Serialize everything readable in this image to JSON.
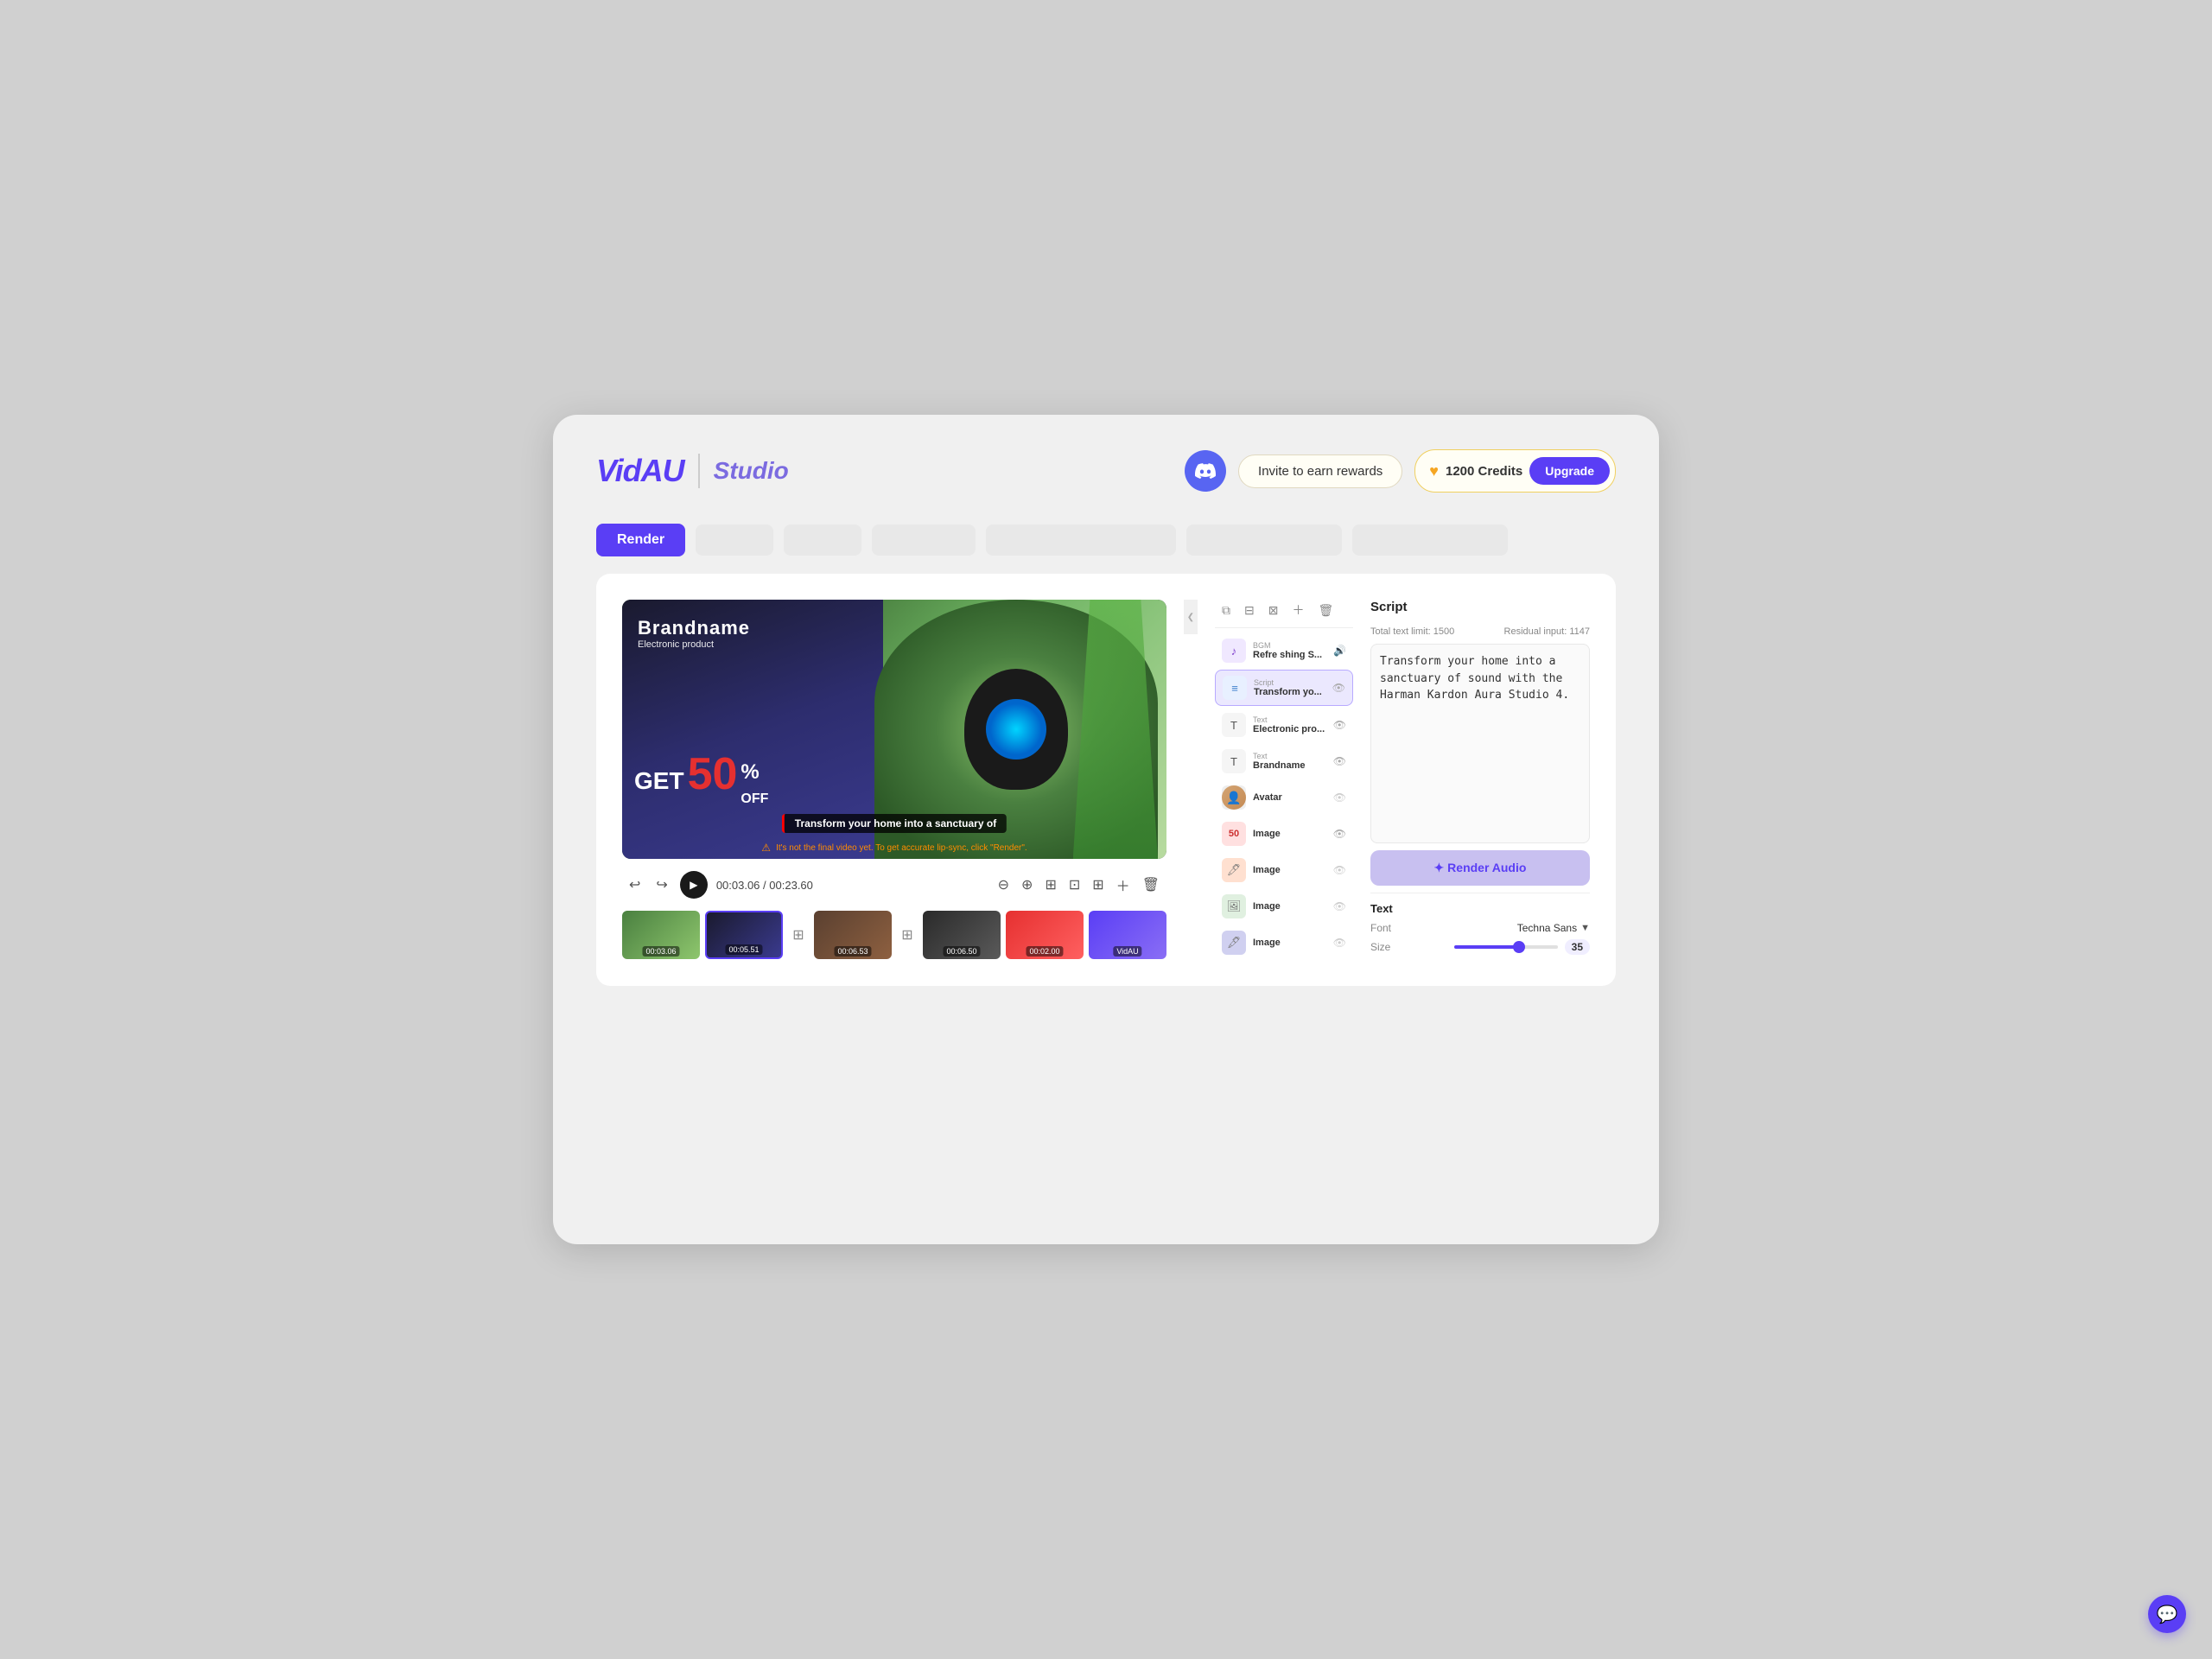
{
  "app": {
    "logo": "VidAU",
    "subtitle": "Studio"
  },
  "header": {
    "discord_label": "Discord",
    "invite_label": "Invite to earn rewards",
    "credits_icon": "♥",
    "credits_amount": "1200 Credits",
    "upgrade_label": "Upgrade"
  },
  "toolbar": {
    "render_label": "Render",
    "tabs": [
      "",
      "",
      "",
      "",
      "",
      ""
    ]
  },
  "video": {
    "ad": {
      "brand": "Brandname",
      "sub": "Electronic product",
      "get": "GET",
      "percent": "50",
      "percent_sign": "%",
      "off": "OFF"
    },
    "subtitle": "Transform your home into a sanctuary of",
    "warning": "It's not the final video yet. To get accurate lip-sync, click \"Render\".",
    "time_current": "00:03.06",
    "time_total": "00:23.60"
  },
  "timeline": {
    "clips": [
      {
        "time": "00:03.06",
        "active": false
      },
      {
        "time": "00:05.51",
        "active": true
      },
      {
        "time": "00:06.53",
        "active": false
      },
      {
        "time": "00:06.50",
        "active": false
      },
      {
        "time": "00:02.00",
        "active": false
      }
    ]
  },
  "layers": {
    "panel_tools": [
      "copy",
      "align-h",
      "align-v",
      "add",
      "delete"
    ],
    "items": [
      {
        "type": "BGM",
        "name": "Refre shing S...",
        "icon_type": "music",
        "visible": true
      },
      {
        "type": "Script",
        "name": "Transform yo...",
        "icon_type": "script",
        "visible": true,
        "active": true
      },
      {
        "type": "Text",
        "name": "Electronic pro...",
        "icon_type": "text",
        "visible": true
      },
      {
        "type": "Text",
        "name": "Brandname",
        "icon_type": "text",
        "visible": true
      },
      {
        "type": "",
        "name": "Avatar",
        "icon_type": "avatar",
        "visible": false
      },
      {
        "type": "",
        "name": "Image",
        "icon_type": "image50",
        "visible": true
      },
      {
        "type": "",
        "name": "Image",
        "icon_type": "img",
        "visible": true
      },
      {
        "type": "",
        "name": "Image",
        "icon_type": "img2",
        "visible": true
      },
      {
        "type": "",
        "name": "Image",
        "icon_type": "img3",
        "visible": true
      }
    ]
  },
  "script": {
    "title": "Script",
    "total_limit_label": "Total text limit: 1500",
    "residual_label": "Residual input: 1147",
    "content": "Transform your home into a sanctuary of sound with the Harman Kardon Aura Studio 4.",
    "render_audio_label": "✦ Render Audio"
  },
  "text_props": {
    "title": "Text",
    "font_label": "Font",
    "font_value": "Techna Sans",
    "size_label": "Size",
    "size_value": "35"
  }
}
